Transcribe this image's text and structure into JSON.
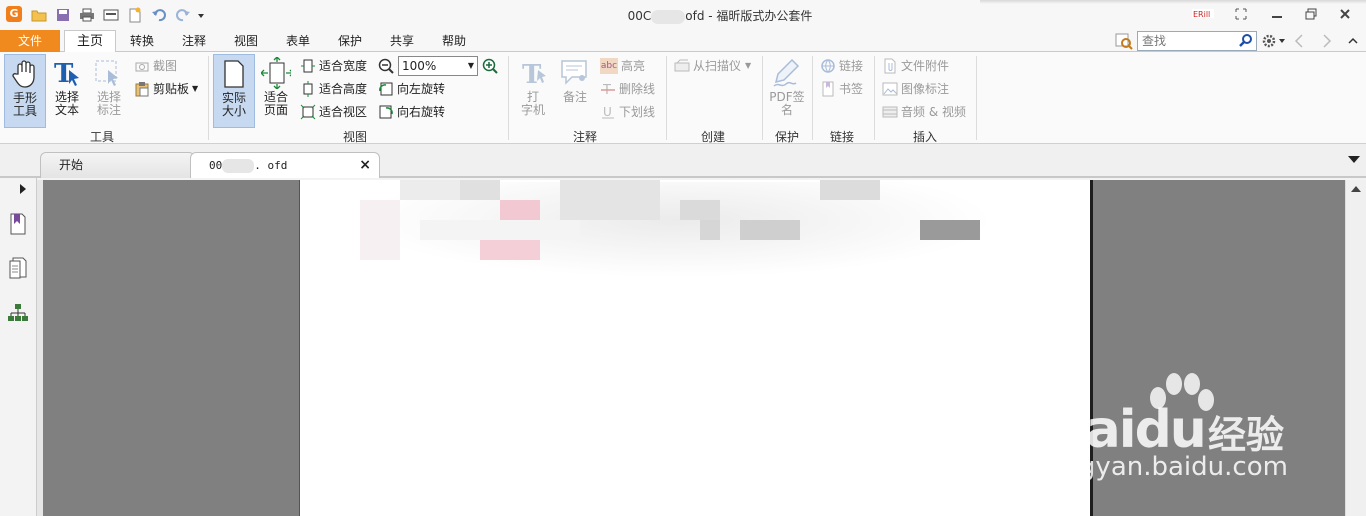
{
  "window": {
    "title_prefix": "00C",
    "title_suffix": "ofd - 福昕版式办公套件",
    "brand_logo_text": "G"
  },
  "menu": {
    "tabs": [
      "文件",
      "主页",
      "转换",
      "注释",
      "视图",
      "表单",
      "保护",
      "共享",
      "帮助"
    ],
    "active": "主页"
  },
  "search": {
    "placeholder": "查找"
  },
  "ribbon": {
    "groups": {
      "tools": "工具",
      "view": "视图",
      "annot": "注释",
      "create": "创建",
      "protect": "保护",
      "link": "链接",
      "insert": "插入"
    },
    "hand_tool": [
      "手形",
      "工具"
    ],
    "select_text": [
      "选择",
      "文本"
    ],
    "select_annot": [
      "选择",
      "标注"
    ],
    "screenshot": "截图",
    "clipboard": "剪贴板",
    "actual_size": [
      "实际",
      "大小"
    ],
    "fit_page": [
      "适合",
      "页面"
    ],
    "fit_width": "适合宽度",
    "fit_height": "适合高度",
    "fit_view": "适合视区",
    "zoom": "100%",
    "rotate_left": "向左旋转",
    "rotate_right": "向右旋转",
    "typewriter": [
      "打",
      "字机"
    ],
    "note": "备注",
    "highlight": "高亮",
    "strikeout": "删除线",
    "underline": "下划线",
    "highlight_icon_text": "abc",
    "from_scanner": "从扫描仪",
    "pdf_sign": [
      "PDF签",
      "名"
    ],
    "link": "链接",
    "bookmark": "书签",
    "file_attach": "文件附件",
    "image_annot": "图像标注",
    "audio_video": "音频 & 视频"
  },
  "doc_tabs": {
    "start": "开始",
    "file_prefix": "00",
    "file_suffix": ". ofd"
  },
  "watermark": {
    "brand": "Bai",
    "brand2": "du",
    "cn": "经验",
    "url": "jingyan.baidu.com"
  },
  "colors": {
    "file_tab": "#f08a1f",
    "active_btn": "#c7d9f0",
    "viewer_bg": "#808080"
  }
}
